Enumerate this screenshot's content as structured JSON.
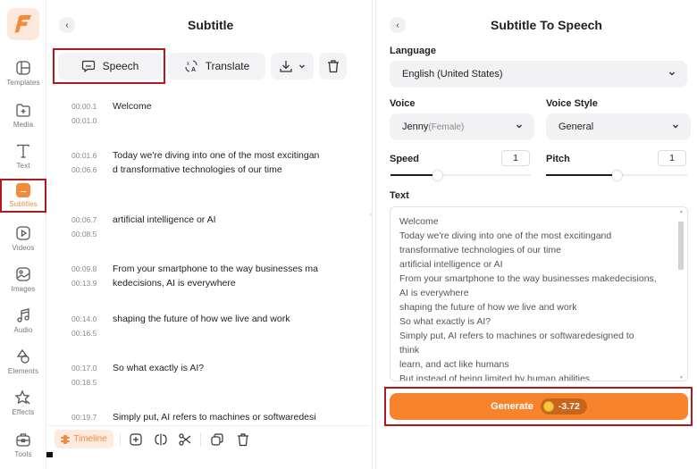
{
  "sidebar": {
    "logo_letter": "F",
    "items": [
      {
        "label": "Templates",
        "icon": "templates-icon"
      },
      {
        "label": "Media",
        "icon": "media-folder-icon"
      },
      {
        "label": "Text",
        "icon": "text-icon"
      },
      {
        "label": "Subtitles",
        "icon": "subtitles-icon",
        "active": true
      },
      {
        "label": "Videos",
        "icon": "videos-icon"
      },
      {
        "label": "Images",
        "icon": "images-icon"
      },
      {
        "label": "Audio",
        "icon": "audio-icon"
      },
      {
        "label": "Elements",
        "icon": "elements-icon"
      },
      {
        "label": "Effects",
        "icon": "effects-icon"
      },
      {
        "label": "Tools",
        "icon": "tools-icon"
      }
    ]
  },
  "subtitle_panel": {
    "back_glyph": "‹",
    "title": "Subtitle",
    "toolbar": {
      "speech_label": "Speech",
      "translate_label": "Translate"
    },
    "cues": [
      {
        "start": "00:00.1",
        "end": "00:01.0",
        "text": "Welcome"
      },
      {
        "start": "00:01.6",
        "end": "00:06.6",
        "text": "Today we're diving into one of the most excitingan\nd transformative technologies of our time"
      },
      {
        "start": "00:06.7",
        "end": "00:08.5",
        "text": "artificial intelligence or AI"
      },
      {
        "start": "00:09.8",
        "end": "00:13.9",
        "text": "From your smartphone to the way businesses ma\nkedecisions, AI is everywhere"
      },
      {
        "start": "00:14.0",
        "end": "00:16.5",
        "text": "shaping the future of how we live and work"
      },
      {
        "start": "00:17.0",
        "end": "00:18.5",
        "text": "So what exactly is AI?"
      },
      {
        "start": "00:19.7",
        "end": "",
        "text": "Simply put, AI refers to machines or softwaredesi"
      }
    ],
    "footer": {
      "timeline_label": "Timeline"
    }
  },
  "speech_panel": {
    "back_glyph": "‹",
    "title": "Subtitle To Speech",
    "language": {
      "label": "Language",
      "value": "English (United States)"
    },
    "voice": {
      "label": "Voice",
      "name": "Jenny",
      "gender": "(Female)"
    },
    "voice_style": {
      "label": "Voice Style",
      "value": "General"
    },
    "speed": {
      "label": "Speed",
      "value": "1",
      "slider_fraction": 0.33
    },
    "pitch": {
      "label": "Pitch",
      "value": "1",
      "slider_fraction": 0.5
    },
    "text": {
      "label": "Text",
      "content": "Welcome\nToday we're diving into one of the most excitingand\ntransformative technologies of our time\nartificial intelligence or AI\nFrom your smartphone to the way businesses makedecisions,\nAI is everywhere\nshaping the future of how we live and work\nSo what exactly is AI?\nSimply put, AI refers to machines or softwaredesigned to\nthink\nlearn, and act like humans\nBut instead of being limited by human abilities"
    },
    "generate": {
      "label": "Generate",
      "cost": "-3.72"
    }
  },
  "colors": {
    "accent": "#f7842d",
    "highlight_box": "#b3191c"
  }
}
